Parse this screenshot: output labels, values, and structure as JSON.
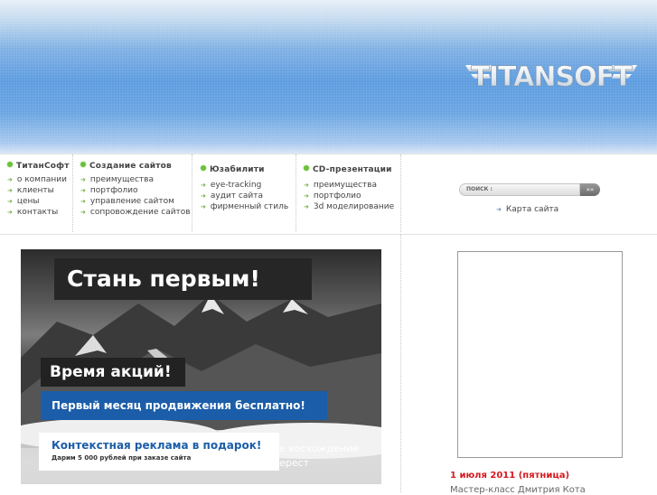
{
  "brand": {
    "logo_text": "TITANSOFT"
  },
  "nav": [
    {
      "title": "ТитанСофт",
      "items": [
        "о компании",
        "клиенты",
        "цены",
        "контакты"
      ]
    },
    {
      "title": "Создание сайтов",
      "items": [
        "преимущества",
        "портфолио",
        "управление сайтом",
        "сопровождение сайтов"
      ]
    },
    {
      "title": "Юзабилити",
      "items": [
        "eye-tracking",
        "аудит сайта",
        "фирменный стиль"
      ]
    },
    {
      "title": "CD-презентации",
      "items": [
        "преимущества",
        "портфолио",
        "3d моделирование"
      ]
    }
  ],
  "search": {
    "label": "ПОИСК :",
    "button": "»»"
  },
  "sitemap": {
    "label": "Карта сайта"
  },
  "banner": {
    "headline": "Стань первым!",
    "promo_title": "Время акций!",
    "promo_line": "Первый месяц продвижения бесплатно!",
    "gift_title": "Контекстная реклама в подарок!",
    "gift_sub": "Дарим 5 000 рублей при заказе сайта",
    "ghost_line1": "е восхождение",
    "ghost_line2": "ерест"
  },
  "news": {
    "date": "1 июля 2011 (пятница)",
    "title": "Мастер-класс Дмитрия Кота"
  },
  "colors": {
    "accent_green": "#6cbf3a",
    "promo_blue": "#1b5da8",
    "date_red": "#d6191e"
  }
}
